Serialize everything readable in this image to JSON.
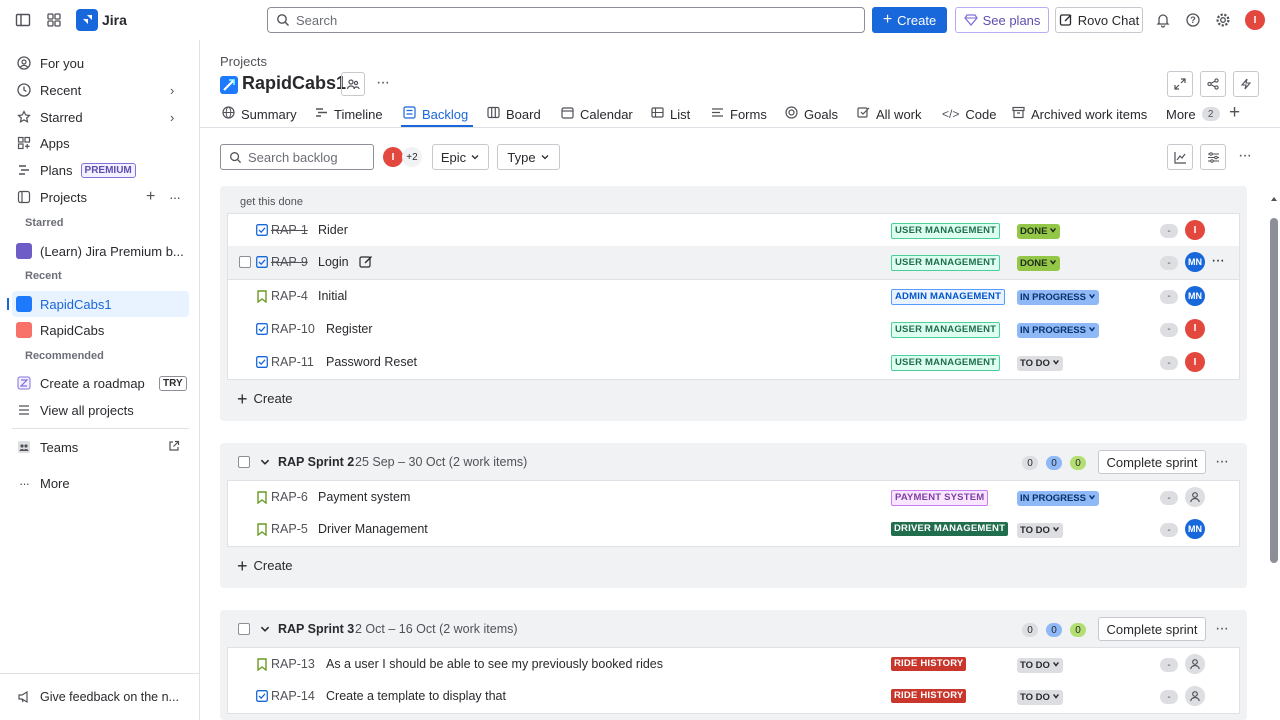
{
  "topbar": {
    "app_name": "Jira",
    "search_placeholder": "Search",
    "create_label": "Create",
    "plans_label": "See plans",
    "rovo_label": "Rovo Chat",
    "user_initial": "I"
  },
  "sidebar": {
    "for_you": "For you",
    "recent": "Recent",
    "starred": "Starred",
    "apps": "Apps",
    "plans": "Plans",
    "premium": "PREMIUM",
    "projects": "Projects",
    "starred_section": "Starred",
    "learn_project": "(Learn) Jira Premium b...",
    "recent_section": "Recent",
    "recent_project_1": "RapidCabs1",
    "recent_project_2": "RapidCabs",
    "recommended_section": "Recommended",
    "create_roadmap": "Create a roadmap",
    "try": "TRY",
    "view_all": "View all projects",
    "teams": "Teams",
    "more": "More",
    "feedback": "Give feedback on the n..."
  },
  "header": {
    "breadcrumb": "Projects",
    "project_name": "RapidCabs1"
  },
  "tabs": {
    "summary": "Summary",
    "timeline": "Timeline",
    "backlog": "Backlog",
    "board": "Board",
    "calendar": "Calendar",
    "list": "List",
    "forms": "Forms",
    "goals": "Goals",
    "all_work": "All work",
    "code": "Code",
    "archived": "Archived work items",
    "more": "More",
    "more_count": "2"
  },
  "filters": {
    "search_placeholder": "Search backlog",
    "avatar_more": "+2",
    "epic": "Epic",
    "type": "Type"
  },
  "sprint1": {
    "goal": "get this done",
    "create": "Create",
    "items": [
      {
        "key": "RAP-1",
        "summary": "Rider",
        "epic": "USER MANAGEMENT",
        "status": "DONE",
        "est": "-",
        "assignee": "I"
      },
      {
        "key": "RAP-9",
        "summary": "Login",
        "epic": "USER MANAGEMENT",
        "status": "DONE",
        "est": "-",
        "assignee": "MN"
      },
      {
        "key": "RAP-4",
        "summary": "Initial",
        "epic": "ADMIN MANAGEMENT",
        "status": "IN PROGRESS",
        "est": "-",
        "assignee": "MN"
      },
      {
        "key": "RAP-10",
        "summary": "Register",
        "epic": "USER MANAGEMENT",
        "status": "IN PROGRESS",
        "est": "-",
        "assignee": "I"
      },
      {
        "key": "RAP-11",
        "summary": "Password Reset",
        "epic": "USER MANAGEMENT",
        "status": "TO DO",
        "est": "-",
        "assignee": "I"
      }
    ]
  },
  "sprint2": {
    "name": "RAP Sprint 2",
    "dates": "25 Sep – 30 Oct (2 work items)",
    "counts": [
      "0",
      "0",
      "0"
    ],
    "complete": "Complete sprint",
    "create": "Create",
    "items": [
      {
        "key": "RAP-6",
        "summary": "Payment system",
        "epic": "PAYMENT SYSTEM",
        "status": "IN PROGRESS",
        "est": "-",
        "assignee": ""
      },
      {
        "key": "RAP-5",
        "summary": "Driver Management",
        "epic": "DRIVER MANAGEMENT",
        "status": "TO DO",
        "est": "-",
        "assignee": "MN"
      }
    ]
  },
  "sprint3": {
    "name": "RAP Sprint 3",
    "dates": "2 Oct – 16 Oct (2 work items)",
    "counts": [
      "0",
      "0",
      "0"
    ],
    "complete": "Complete sprint",
    "items": [
      {
        "key": "RAP-13",
        "summary": "As a user I should be able to see my previously booked rides",
        "epic": "RIDE HISTORY",
        "status": "TO DO",
        "est": "-",
        "assignee": ""
      },
      {
        "key": "RAP-14",
        "summary": "Create a template to display that",
        "epic": "RIDE HISTORY",
        "status": "TO DO",
        "est": "-",
        "assignee": ""
      }
    ]
  },
  "colors": {
    "accent": "#1868db",
    "avatar_i": "#e2483d",
    "avatar_mn": "#1868db"
  }
}
